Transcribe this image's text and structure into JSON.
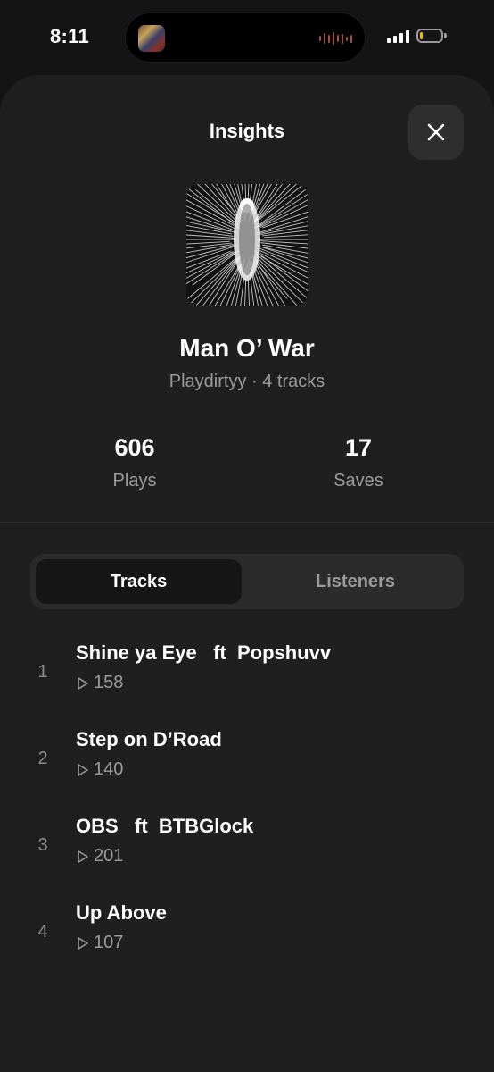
{
  "status_bar": {
    "time": "8:11",
    "battery_level": 0.15,
    "battery_color": "#f2c200"
  },
  "sheet": {
    "title": "Insights",
    "close_icon": "close-icon"
  },
  "album": {
    "title": "Man O’ War",
    "meta": "Playdirtyy · 4 tracks"
  },
  "stats": {
    "plays_value": "606",
    "plays_label": "Plays",
    "saves_value": "17",
    "saves_label": "Saves"
  },
  "tabs": [
    {
      "label": "Tracks",
      "active": true
    },
    {
      "label": "Listeners",
      "active": false
    }
  ],
  "tracks": [
    {
      "index": "1",
      "name": "Shine ya Eye   ft  Popshuvv",
      "plays": "158"
    },
    {
      "index": "2",
      "name": "Step on D’Road",
      "plays": "140"
    },
    {
      "index": "3",
      "name": "OBS   ft  BTBGlock",
      "plays": "201"
    },
    {
      "index": "4",
      "name": "Up Above",
      "plays": "107"
    }
  ],
  "colors": {
    "background": "#141414",
    "sheet": "#1f1f1f",
    "muted_text": "#9b9b9b"
  }
}
